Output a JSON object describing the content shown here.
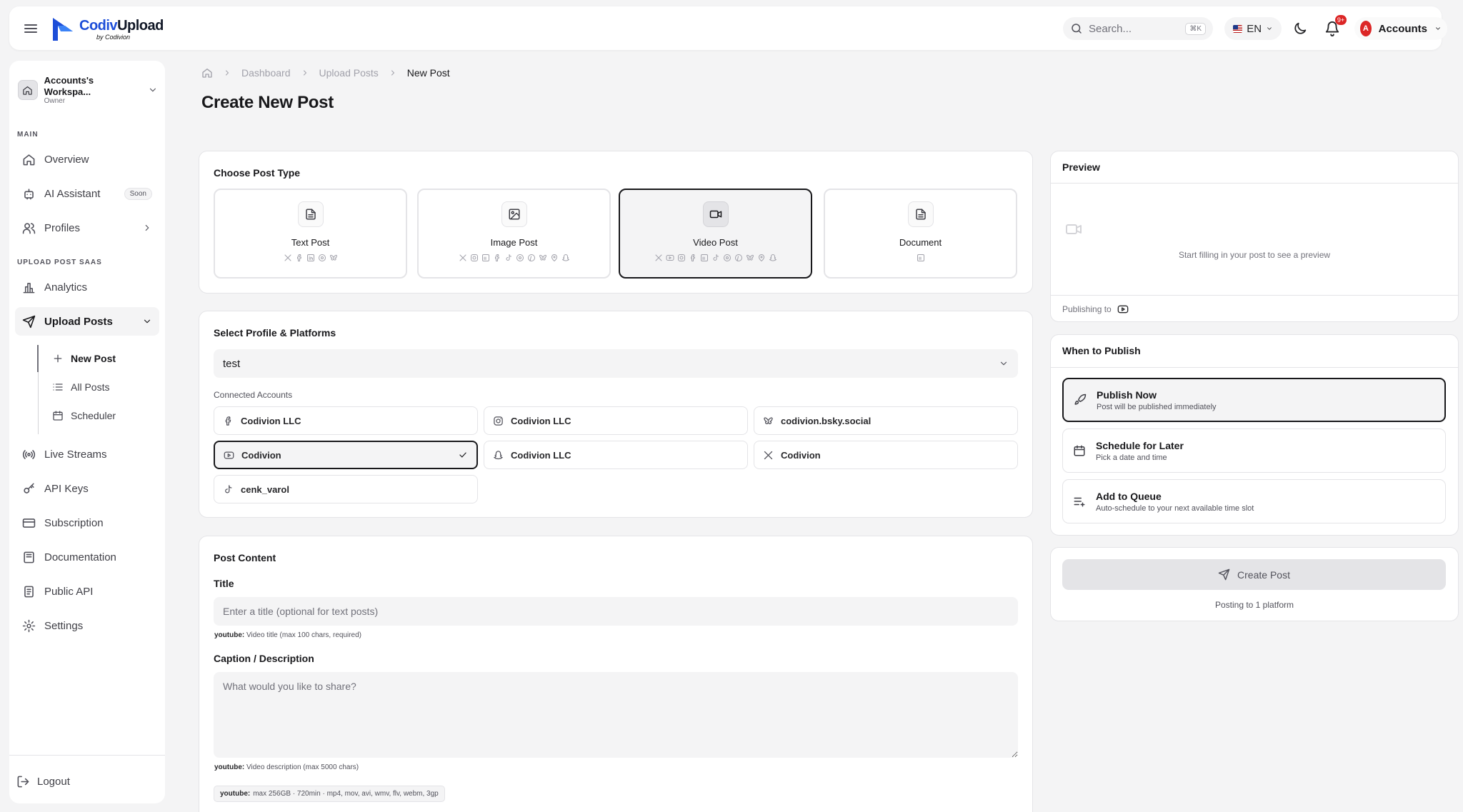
{
  "app": {
    "name_a": "Codiv",
    "name_b": "Upload",
    "by": "by Codivion"
  },
  "header": {
    "search_placeholder": "Search...",
    "search_shortcut": "⌘K",
    "language": "EN",
    "notification_count": "9+",
    "account_initial": "A",
    "account_label": "Accounts"
  },
  "sidebar": {
    "workspace_name": "Accounts's Workspa...",
    "workspace_role": "Owner",
    "section_main": "MAIN",
    "overview": "Overview",
    "ai_assistant": "AI Assistant",
    "soon_badge": "Soon",
    "profiles": "Profiles",
    "section_saas": "UPLOAD POST SAAS",
    "analytics": "Analytics",
    "upload_posts": "Upload Posts",
    "new_post": "New Post",
    "all_posts": "All Posts",
    "scheduler": "Scheduler",
    "live_streams": "Live Streams",
    "api_keys": "API Keys",
    "subscription": "Subscription",
    "documentation": "Documentation",
    "public_api": "Public API",
    "settings": "Settings",
    "logout": "Logout"
  },
  "breadcrumb": {
    "dashboard": "Dashboard",
    "upload_posts": "Upload Posts",
    "current": "New Post"
  },
  "page_title": "Create New Post",
  "post_type": {
    "title": "Choose Post Type",
    "types": [
      {
        "label": "Text Post",
        "icon": "file-text-icon"
      },
      {
        "label": "Image Post",
        "icon": "image-icon"
      },
      {
        "label": "Video Post",
        "icon": "video-icon",
        "selected": true
      },
      {
        "label": "Document",
        "icon": "document-icon"
      }
    ]
  },
  "profile": {
    "title": "Select Profile & Platforms",
    "selected_profile": "test",
    "connected_label": "Connected Accounts",
    "accounts": [
      {
        "platform": "facebook",
        "name": "Codivion LLC"
      },
      {
        "platform": "instagram",
        "name": "Codivion LLC"
      },
      {
        "platform": "bluesky",
        "name": "codivion.bsky.social"
      },
      {
        "platform": "youtube",
        "name": "Codivion",
        "selected": true
      },
      {
        "platform": "snapchat",
        "name": "Codivion LLC"
      },
      {
        "platform": "x",
        "name": "Codivion"
      },
      {
        "platform": "tiktok",
        "name": "cenk_varol"
      }
    ]
  },
  "content": {
    "title": "Post Content",
    "title_label": "Title",
    "title_placeholder": "Enter a title (optional for text posts)",
    "title_hint_key": "youtube:",
    "title_hint": "Video title (max 100 chars, required)",
    "caption_label": "Caption / Description",
    "caption_placeholder": "What would you like to share?",
    "caption_hint_key": "youtube:",
    "caption_hint": "Video description (max 5000 chars)",
    "media_hint_key": "youtube:",
    "media_hint": "max 256GB · 720min · mp4, mov, avi, wmv, flv, webm, 3gp"
  },
  "preview": {
    "title": "Preview",
    "empty_text": "Start filling in your post to see a preview",
    "publishing_to": "Publishing to"
  },
  "publish": {
    "title": "When to Publish",
    "options": [
      {
        "title": "Publish Now",
        "sub": "Post will be published immediately",
        "selected": true
      },
      {
        "title": "Schedule for Later",
        "sub": "Pick a date and time"
      },
      {
        "title": "Add to Queue",
        "sub": "Auto-schedule to your next available time slot"
      }
    ],
    "create_label": "Create Post",
    "posting_to": "Posting to 1 platform"
  },
  "colors": {
    "accent": "#18181b",
    "brand": "#1d4ed8",
    "badge": "#dc2626",
    "background": "#f4f4f5"
  }
}
